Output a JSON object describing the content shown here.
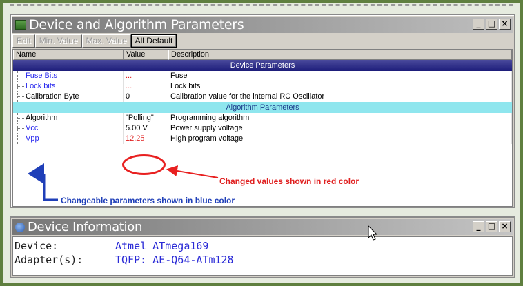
{
  "device_window": {
    "title": "Device and Algorithm Parameters",
    "controls": {
      "minimize": "_",
      "restore": "□",
      "close": "×"
    },
    "toolbar": {
      "edit": "Edit",
      "min_value": "Min. Value",
      "max_value": "Max. Value",
      "all_default": "All Default"
    },
    "columns": {
      "name": "Name",
      "value": "Value",
      "description": "Description"
    },
    "sections": [
      {
        "title": "Device Parameters",
        "rows": [
          {
            "name": "Fuse Bits",
            "value": "...",
            "description": "Fuse"
          },
          {
            "name": "Lock bits",
            "value": "...",
            "description": "Lock bits"
          },
          {
            "name": "Calibration Byte",
            "value": "0",
            "description": "Calibration value for the internal RC Oscillator"
          }
        ]
      },
      {
        "title": "Algorithm Parameters",
        "rows": [
          {
            "name": "Algorithm",
            "value": "\"Polling\"",
            "description": "Programming algorithm"
          },
          {
            "name": "Vcc",
            "value": "5.00 V",
            "description": "Power supply voltage"
          },
          {
            "name": "Vpp",
            "value": "12.25",
            "description": "High program voltage"
          }
        ]
      }
    ],
    "annotations": {
      "changed_values": "Changed values shown in red color",
      "changeable_params": "Changeable parameters shown in blue color"
    }
  },
  "info_window": {
    "title": "Device Information",
    "controls": {
      "minimize": "_",
      "restore": "□",
      "close": "×"
    },
    "fields": [
      {
        "label": "Device:",
        "value": "Atmel ATmega169"
      },
      {
        "label": "Adapter(s):",
        "value": "TQFP: AE-Q64-ATm128"
      }
    ]
  },
  "colors": {
    "changed_value": "#e02020",
    "changeable_param": "#2a2aee",
    "device_section": "#1d1d7a",
    "algorithm_section": "#8fe6ee",
    "frame": "#5f7f3f"
  }
}
